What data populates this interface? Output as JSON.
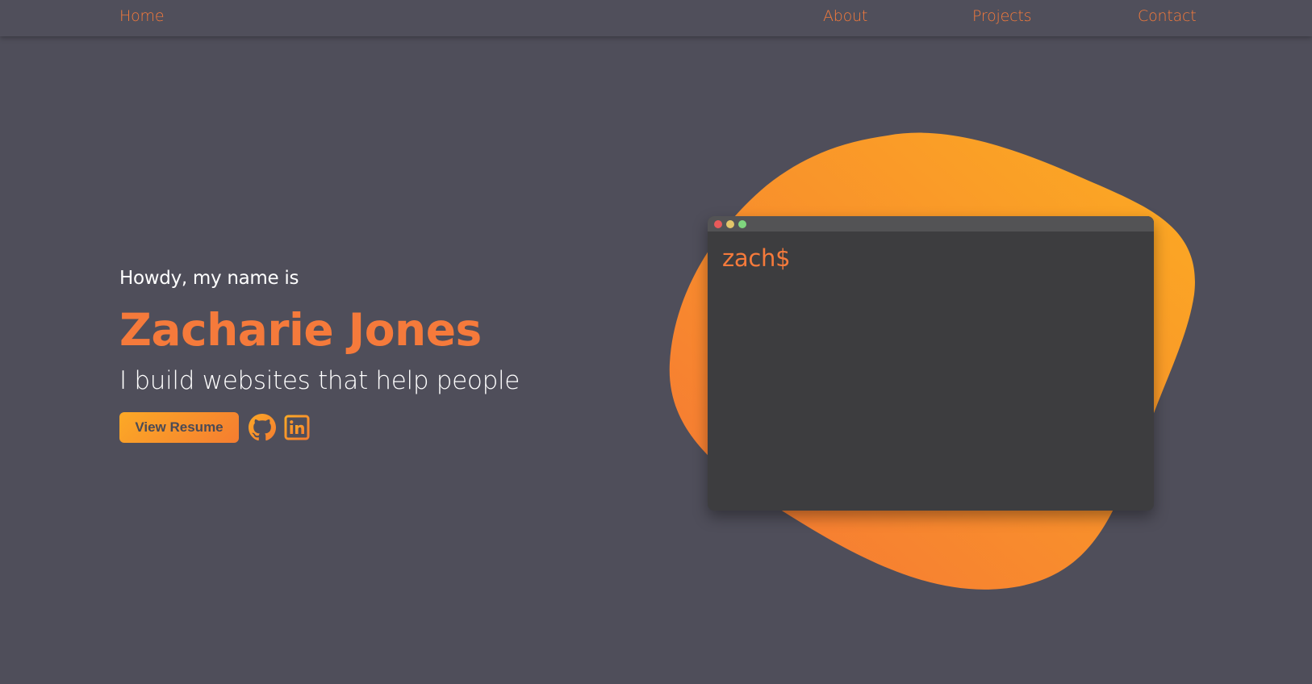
{
  "nav": {
    "home": "Home",
    "about": "About",
    "projects": "Projects",
    "contact": "Contact"
  },
  "hero": {
    "greeting": "Howdy, my name is",
    "name": "Zacharie Jones",
    "tagline": "I build websites that help people",
    "resume_button": "View Resume"
  },
  "social": [
    {
      "icon": "github-icon"
    },
    {
      "icon": "linkedin-icon"
    }
  ],
  "terminal": {
    "prompt": "zach$",
    "window_buttons": [
      "red",
      "yellow",
      "green"
    ]
  },
  "colors": {
    "background": "#4f4e5a",
    "accent": "#f57a3b",
    "gradient_start": "#fca926",
    "gradient_end": "#f57d30",
    "terminal": "#3d3d3f"
  }
}
